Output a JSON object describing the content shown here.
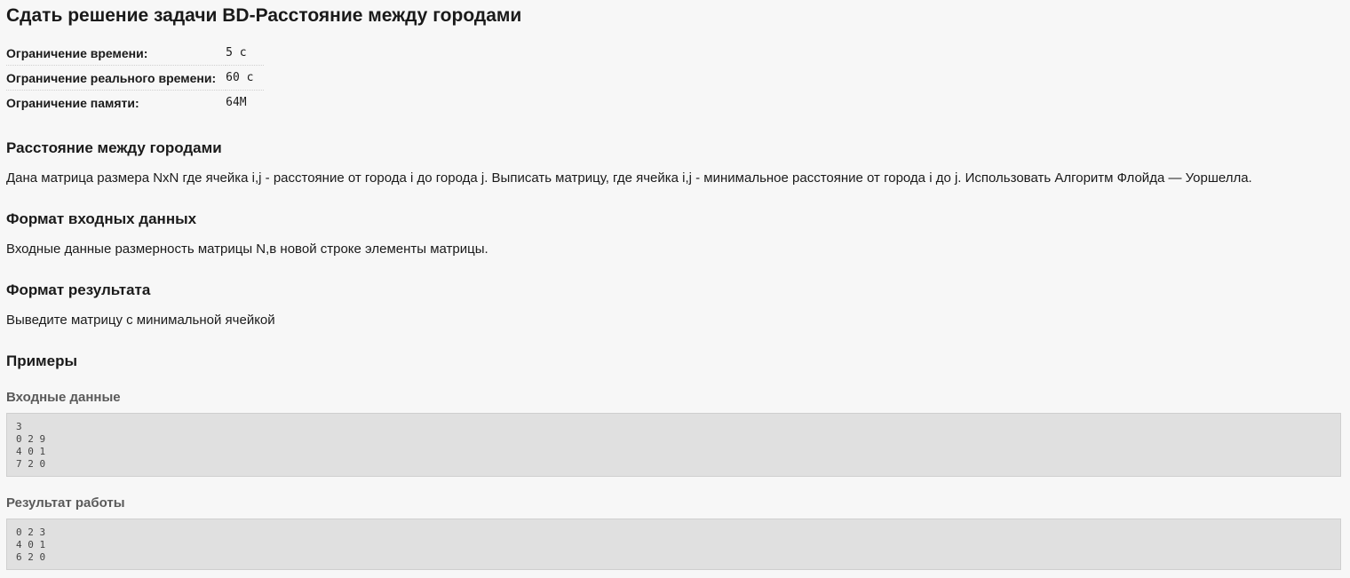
{
  "title": "Сдать решение задачи BD-Расстояние между городами",
  "limits": [
    {
      "label": "Ограничение времени:",
      "value": "5 с"
    },
    {
      "label": "Ограничение реального времени:",
      "value": "60 с"
    },
    {
      "label": "Ограничение памяти:",
      "value": "64M"
    }
  ],
  "problem": {
    "heading": "Расстояние между городами",
    "statement": "Дана матрица размера NxN где ячейка i,j - расстояние от города i до города j. Выписать матрицу, где ячейка i,j - минимальное расстояние от города i до j. Использовать Алгоритм Флойда — Уоршелла."
  },
  "input_format": {
    "heading": "Формат входных данных",
    "text": "Входные данные размерность матрицы N,в новой строке элементы матрицы."
  },
  "output_format": {
    "heading": "Формат результата",
    "text": "Выведите матрицу с минимальной ячейкой"
  },
  "examples": {
    "heading": "Примеры",
    "input_label": "Входные данные",
    "input_value": "3\n0 2 9\n4 0 1\n7 2 0",
    "output_label": "Результат работы",
    "output_value": "0 2 3\n4 0 1\n6 2 0"
  }
}
